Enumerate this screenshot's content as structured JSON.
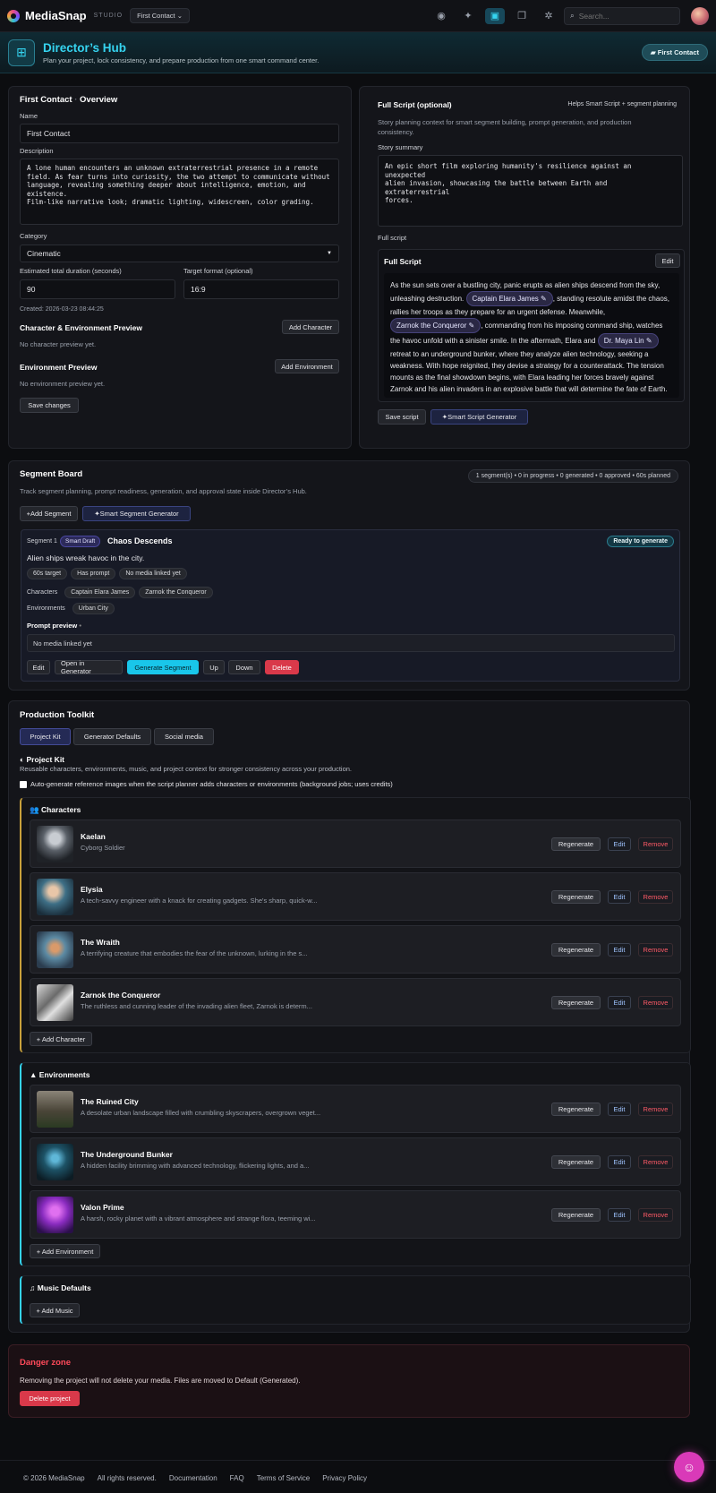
{
  "topbar": {
    "brand": "MediaSnap",
    "studio": "STUDIO",
    "project_chip": "First Contact",
    "search_placeholder": "Search..."
  },
  "hub": {
    "title": "Director’s Hub",
    "subtitle": "Plan your project, lock consistency, and prepare production from one smart command center.",
    "project_button": "First Contact"
  },
  "overview": {
    "breadcrumb_project": "First Contact",
    "breadcrumb_sep": "·",
    "breadcrumb_page": "Overview",
    "name_label": "Name",
    "name_value": "First Contact",
    "description_label": "Description",
    "description_value": "A lone human encounters an unknown extraterrestrial presence in a remote\nfield. As fear turns into curiosity, the two attempt to communicate without\nlanguage, revealing something deeper about intelligence, emotion, and\nexistence.\nFilm-like narrative look; dramatic lighting, widescreen, color grading.",
    "category_label": "Category",
    "category_value": "Cinematic",
    "duration_label": "Estimated total duration (seconds)",
    "duration_value": "90",
    "format_label": "Target format (optional)",
    "format_value": "16:9",
    "created": "Created: 2026-03-23 08:44:25",
    "char_preview_title": "Character & Environment Preview",
    "add_character": "Add Character",
    "no_char_preview": "No character preview yet.",
    "env_preview_title": "Environment Preview",
    "add_environment": "Add Environment",
    "no_env_preview": "No environment preview yet.",
    "save_changes": "Save changes"
  },
  "script": {
    "title": "Full Script (optional)",
    "hint": "Helps Smart Script + segment planning",
    "description": "Story planning context for smart segment building, prompt generation, and production consistency.",
    "summary_label": "Story summary",
    "summary_value": "An epic short film exploring humanity's resilience against an unexpected\nalien invasion, showcasing the battle between Earth and extraterrestrial\nforces.",
    "full_script_label": "Full script",
    "inner_title": "Full Script",
    "edit": "Edit",
    "p1": "As the sun sets over a bustling city, panic erupts as alien ships descend from the sky, unleashing destruction.",
    "chip1": "Captain Elara James ✎",
    "p2": ", standing resolute amidst the chaos, rallies her troops as they prepare for an urgent defense. Meanwhile,",
    "chip2": "Zarnok the Conqueror ✎",
    "p3": ", commanding from his imposing command ship, watches the havoc unfold with a sinister smile. In the aftermath, Elara and",
    "chip3": "Dr. Maya Lin ✎",
    "p4": "retreat to an underground bunker, where they analyze alien technology, seeking a weakness. With hope reignited, they devise a strategy for a counterattack. The tension mounts as the final showdown begins, with Elara leading her forces bravely against Zarnok and his alien invaders in an explosive battle that will determine the fate of Earth.",
    "save_script": "Save script",
    "smart_generator": "Smart Script Generator"
  },
  "segments": {
    "title": "Segment Board",
    "summary": "1 segment(s) • 0 in progress • 0 generated • 0 approved • 60s planned",
    "subtitle": "Track segment planning, prompt readiness, generation, and approval state inside Director’s Hub.",
    "add_segment": "Add Segment",
    "smart_segment": "Smart Segment Generator",
    "seg_number": "Segment 1",
    "seg_badge": "Smart Draft",
    "seg_title": "Chaos Descends",
    "seg_status": "Ready to generate",
    "seg_desc": "Alien ships wreak havoc in the city.",
    "tags": [
      "60s target",
      "Has prompt",
      "No media linked yet"
    ],
    "characters_label": "Characters",
    "characters": [
      "Captain Elara James",
      "Zarnok the Conqueror"
    ],
    "environments_label": "Environments",
    "environments": [
      "Urban City"
    ],
    "prompt_preview": "Prompt preview",
    "prompt_dot": "•",
    "no_media": "No media linked yet",
    "actions": {
      "edit": "Edit",
      "open": "Open in Generator",
      "generate": "Generate Segment",
      "up": "Up",
      "down": "Down",
      "delete": "Delete"
    }
  },
  "toolkit": {
    "title": "Production Toolkit",
    "tabs": [
      "Project Kit",
      "Generator Defaults",
      "Social media"
    ],
    "kit_title": "Project Kit",
    "kit_desc": "Reusable characters, environments, music, and project context for stronger consistency across your production.",
    "auto_gen": "Auto-generate reference images when the script planner adds characters or environments (background jobs; uses credits)",
    "characters_title": "Characters",
    "characters": [
      {
        "name": "Kaelan",
        "desc": "Cyborg Soldier"
      },
      {
        "name": "Elysia",
        "desc": "A tech-savvy engineer with a knack for creating gadgets. She's sharp, quick-w..."
      },
      {
        "name": "The Wraith",
        "desc": "A terrifying creature that embodies the fear of the unknown, lurking in the s..."
      },
      {
        "name": "Zarnok the Conqueror",
        "desc": "The ruthless and cunning leader of the invading alien fleet, Zarnok is determ..."
      }
    ],
    "add_character": "+ Add Character",
    "environments_title": "Environments",
    "environments": [
      {
        "name": "The Ruined City",
        "desc": "A desolate urban landscape filled with crumbling skyscrapers, overgrown veget..."
      },
      {
        "name": "The Underground Bunker",
        "desc": "A hidden facility brimming with advanced technology, flickering lights, and a..."
      },
      {
        "name": "Valon Prime",
        "desc": "A harsh, rocky planet with a vibrant atmosphere and strange flora, teeming wi..."
      }
    ],
    "add_environment": "+ Add Environment",
    "music_title": "Music Defaults",
    "add_music": "+ Add Music",
    "regenerate": "Regenerate",
    "edit": "Edit",
    "remove": "Remove"
  },
  "danger": {
    "title": "Danger zone",
    "text": "Removing the project will not delete your media. Files are moved to Default (Generated).",
    "button": "Delete project"
  },
  "footer": {
    "copyright": "© 2026 MediaSnap",
    "rights": "All rights reserved.",
    "links": [
      "Documentation",
      "FAQ",
      "Terms of Service",
      "Privacy Policy"
    ]
  },
  "colors": {
    "accent": "#35d4f0",
    "danger": "#d9394a",
    "purple": "#7c6cf0",
    "gold": "#c9a13b"
  }
}
